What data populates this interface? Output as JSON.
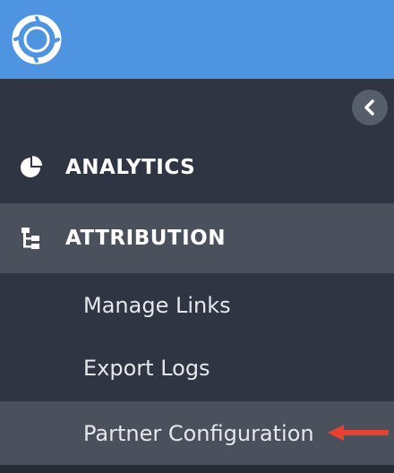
{
  "header": {
    "brand_color": "#4e94e0",
    "logo_icon": "aperture-logo-icon"
  },
  "sidebar": {
    "collapse_icon": "chevron-left-icon",
    "items": [
      {
        "label": "ANALYTICS",
        "icon": "pie-chart-icon"
      },
      {
        "label": "ATTRIBUTION",
        "icon": "hierarchy-icon"
      }
    ],
    "subitems": [
      {
        "label": "Manage Links"
      },
      {
        "label": "Export Logs"
      },
      {
        "label": "Partner Configuration"
      }
    ]
  },
  "annotation": {
    "arrow_icon": "red-arrow-icon",
    "color": "#e8412f"
  }
}
